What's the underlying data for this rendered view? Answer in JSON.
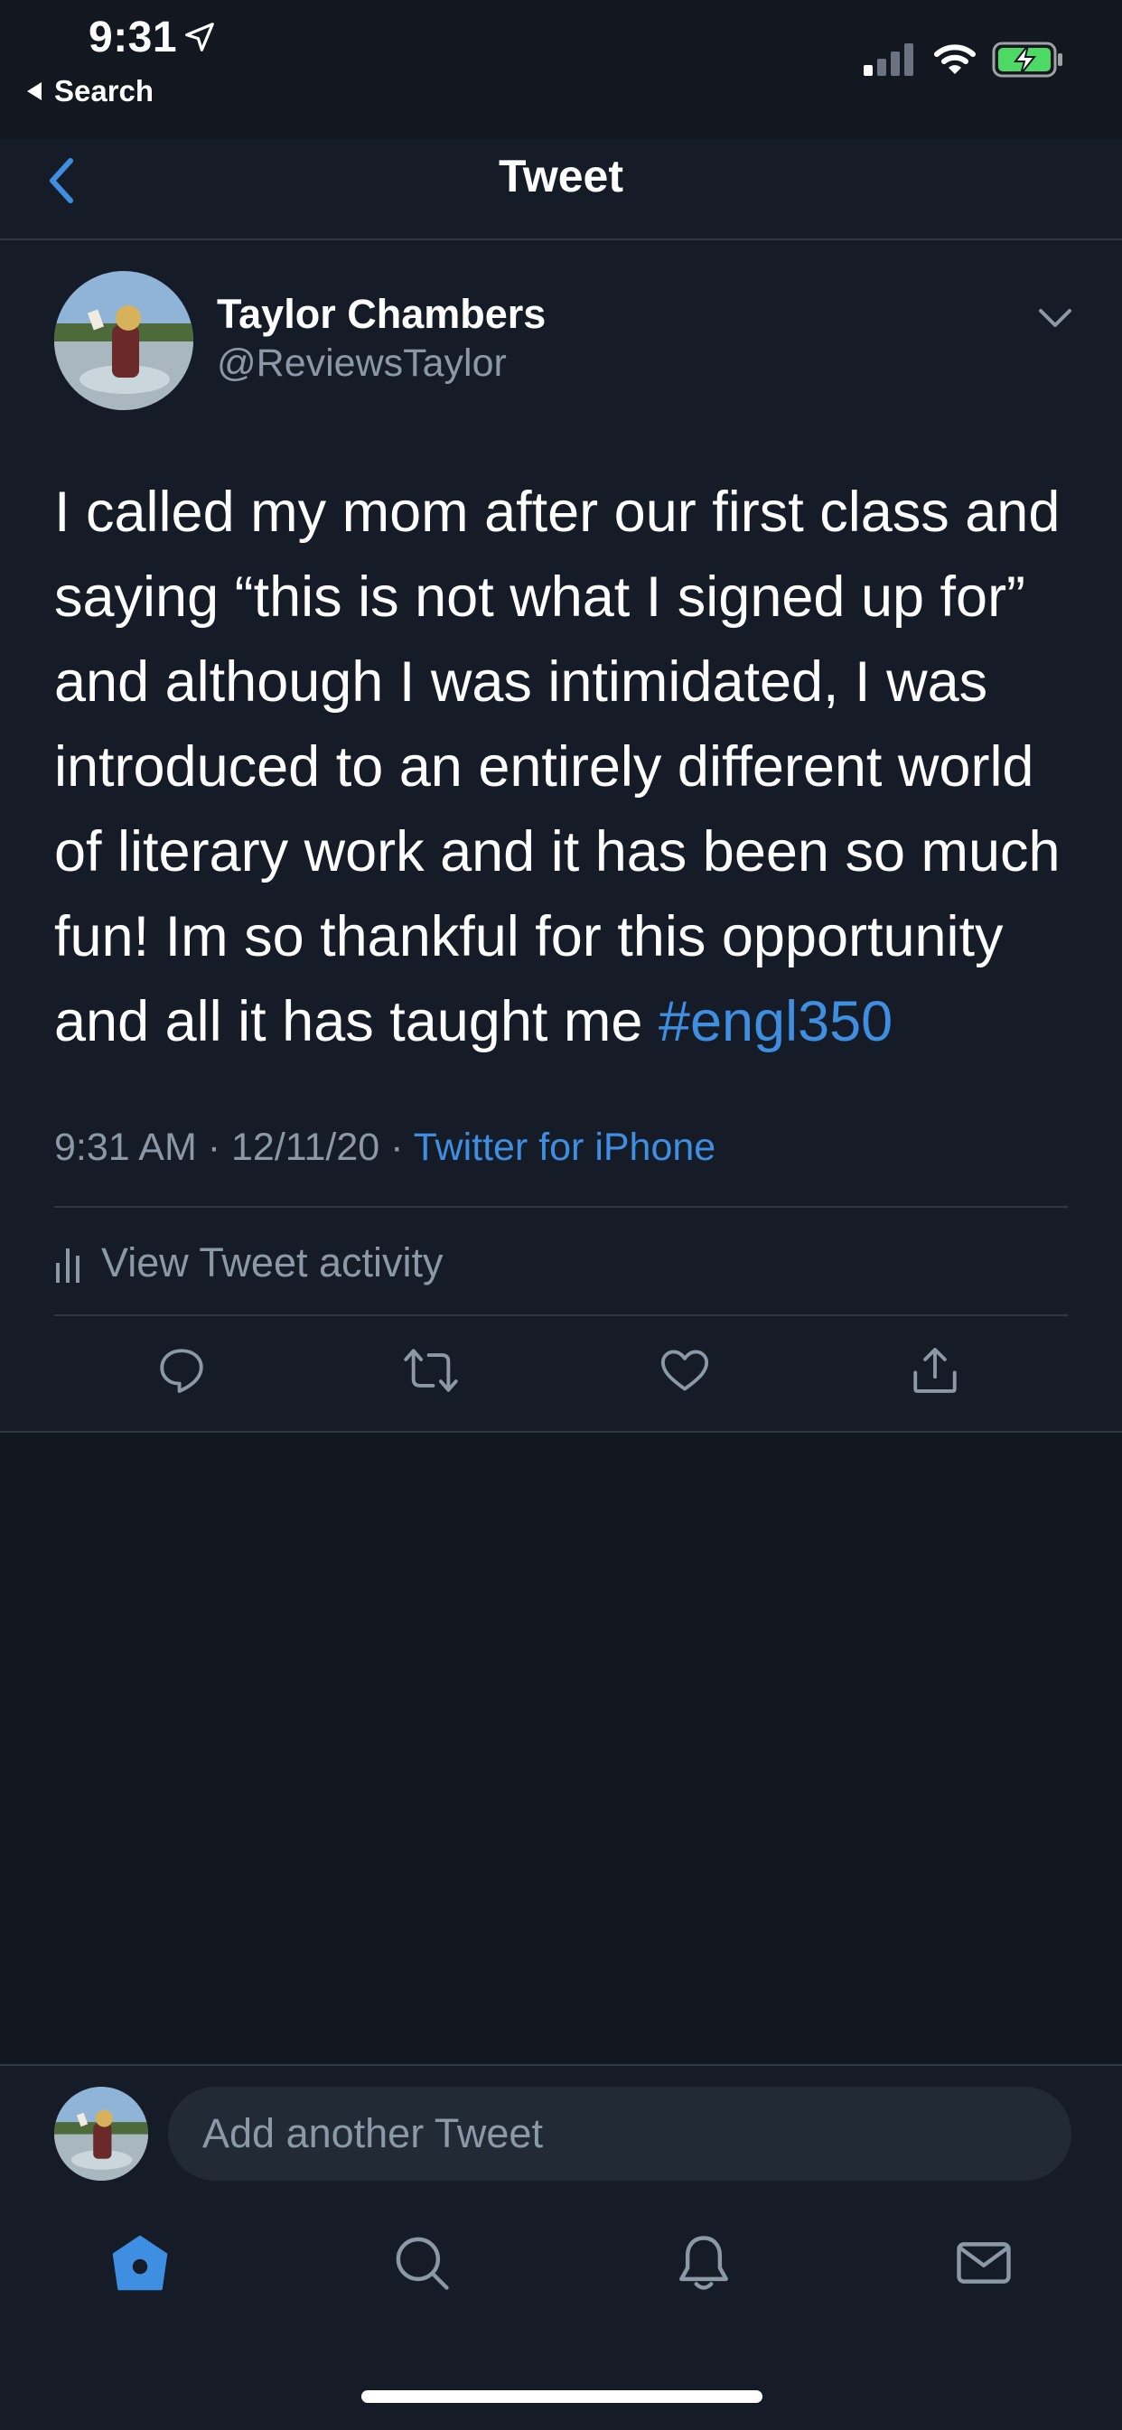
{
  "status_bar": {
    "time": "9:31",
    "back_label": "Search"
  },
  "header": {
    "title": "Tweet"
  },
  "tweet": {
    "author_name": "Taylor Chambers",
    "author_handle": "@ReviewsTaylor",
    "text_lines": [
      "I called my mom after our first class and",
      "saying “this is not what I signed up for”",
      "and although I was intimidated, I was",
      "introduced to an entirely different world",
      "of literary work and it has been so much",
      "fun! Im so thankful for this opportunity",
      "and all it has taught me "
    ],
    "hashtag": "#engl350",
    "time": "9:31 AM",
    "date": "12/11/20",
    "source": "Twitter for iPhone",
    "separator": " · ",
    "activity_label": "View Tweet activity"
  },
  "reply": {
    "placeholder": "Add another Tweet"
  },
  "colors": {
    "background": "#121720",
    "panel": "#161c27",
    "accent": "#3e8fe1",
    "muted": "#8b98a5",
    "battery": "#4cd964"
  },
  "icons": {
    "actions": [
      "reply-icon",
      "retweet-icon",
      "like-icon",
      "share-icon"
    ],
    "tabs": [
      "home-icon",
      "search-icon",
      "notifications-icon",
      "messages-icon"
    ]
  }
}
